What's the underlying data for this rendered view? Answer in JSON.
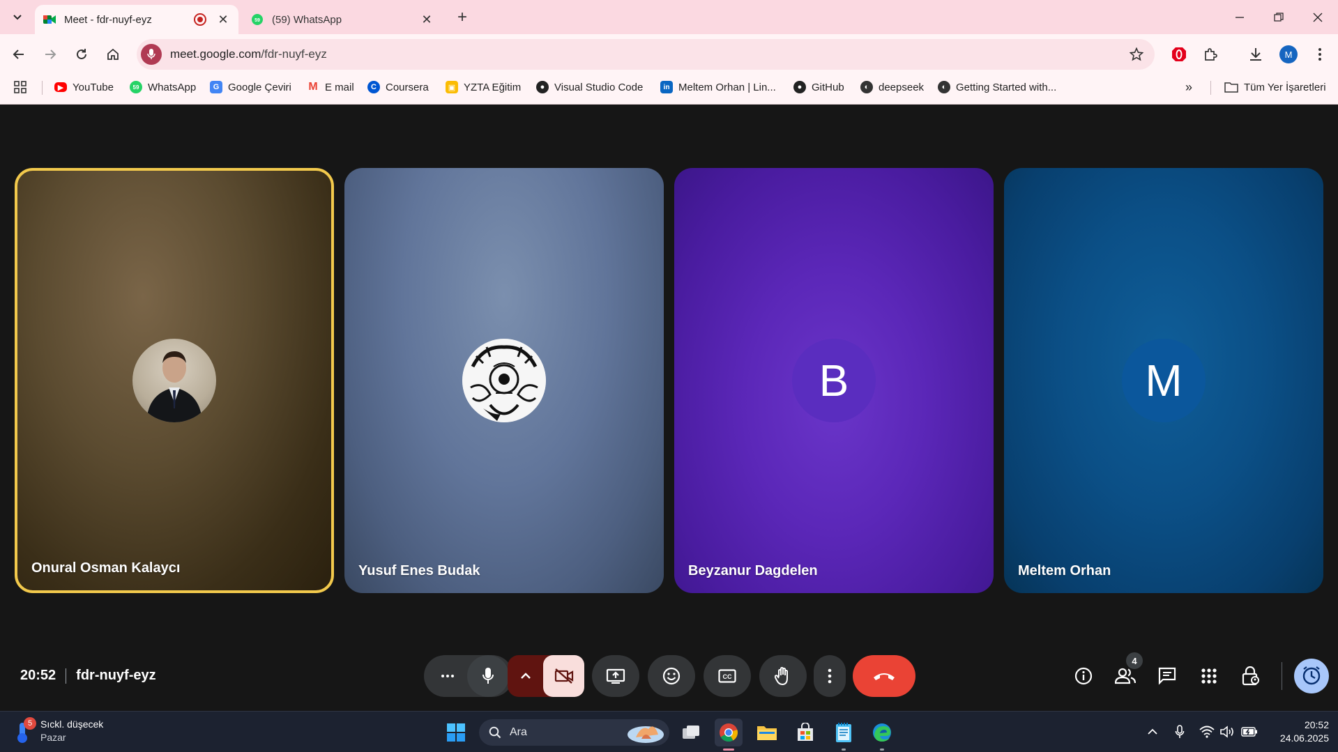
{
  "browser": {
    "tabs": [
      {
        "title": "Meet - fdr-nuyf-eyz",
        "active": true
      },
      {
        "title": "(59) WhatsApp",
        "active": false,
        "badge": "59"
      }
    ],
    "url_host": "meet.google.com",
    "url_path": "/fdr-nuyf-eyz",
    "profile_initial": "M",
    "bookmarks": [
      {
        "label": "YouTube",
        "icon": "youtube-icon"
      },
      {
        "label": "WhatsApp",
        "icon": "whatsapp-icon"
      },
      {
        "label": "Google Çeviri",
        "icon": "translate-icon"
      },
      {
        "label": "E mail",
        "icon": "gmail-icon"
      },
      {
        "label": "Coursera",
        "icon": "coursera-icon"
      },
      {
        "label": "YZTA Eğitim",
        "icon": "classroom-icon"
      },
      {
        "label": "Visual Studio Code",
        "icon": "github-icon"
      },
      {
        "label": "Meltem Orhan | Lin...",
        "icon": "linkedin-icon"
      },
      {
        "label": "GitHub",
        "icon": "github-icon"
      },
      {
        "label": "deepseek",
        "icon": "globe-icon"
      },
      {
        "label": "Getting Started with...",
        "icon": "globe-icon"
      }
    ],
    "all_bookmarks_label": "Tüm Yer İşaretleri"
  },
  "meet": {
    "participants": [
      {
        "name": "Onural Osman Kalaycı",
        "avatar": "photo",
        "speaking": true
      },
      {
        "name": "Yusuf Enes Budak",
        "avatar": "illustration"
      },
      {
        "name": "Beyzanur Dagdelen",
        "avatar_letter": "B",
        "avatar_color": "#5a2dbf"
      },
      {
        "name": "Meltem Orhan",
        "avatar_letter": "M",
        "avatar_color": "#0b579c"
      }
    ],
    "time": "20:52",
    "meeting_code": "fdr-nuyf-eyz",
    "people_count": "4",
    "accent_end_call": "#ea4335",
    "accent_speaking_border": "#f2c94c"
  },
  "taskbar": {
    "weather_badge": "5",
    "weather_title": "Sıckl. düşecek",
    "weather_sub": "Pazar",
    "search_placeholder": "Ara",
    "clock_time": "20:52",
    "clock_date": "24.06.2025"
  }
}
